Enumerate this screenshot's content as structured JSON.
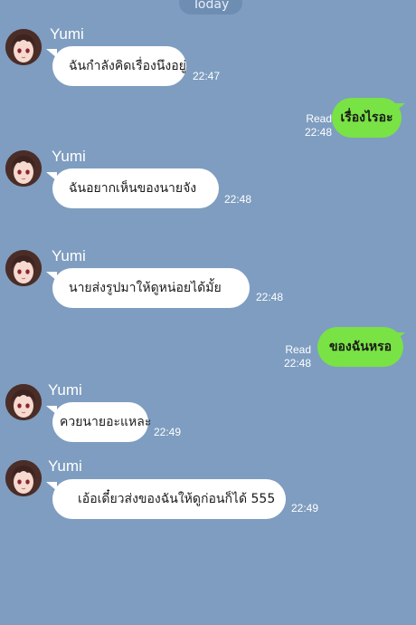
{
  "date_label": "Today",
  "contact": {
    "name": "Yumi"
  },
  "messages": [
    {
      "from": "Yumi",
      "text": "ฉันกำลังคิดเรื่องนึงอยู่",
      "time": "22:47"
    },
    {
      "from": "me",
      "text": "เรื่องไรอะ",
      "status": "Read",
      "time": "22:48"
    },
    {
      "from": "Yumi",
      "text": "ฉันอยากเห็นของนายจัง",
      "time": "22:48"
    },
    {
      "from": "Yumi",
      "text": "นายส่งรูปมาให้ดูหน่อยได้มั้ย",
      "time": "22:48"
    },
    {
      "from": "me",
      "text": "ของฉันหรอ",
      "status": "Read",
      "time": "22:48"
    },
    {
      "from": "Yumi",
      "text": "ควยนายอะแหละ",
      "time": "22:49"
    },
    {
      "from": "Yumi",
      "text": "เอ้อเดี๋ยวส่งของฉันให้ดูก่อนก็ได้ 555",
      "time": "22:49"
    }
  ],
  "colors": {
    "background": "#7e9dc0",
    "incoming_bubble": "#ffffff",
    "outgoing_bubble": "#79e245"
  }
}
